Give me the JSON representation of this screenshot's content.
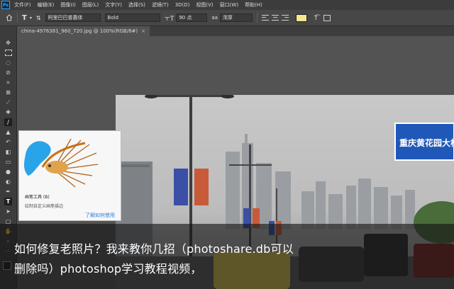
{
  "app": {
    "logo": "Ps"
  },
  "menu": [
    "文件(F)",
    "编辑(E)",
    "图像(I)",
    "图层(L)",
    "文字(Y)",
    "选择(S)",
    "滤镜(T)",
    "3D(D)",
    "视图(V)",
    "窗口(W)",
    "帮助(H)"
  ],
  "options": {
    "tool_icon": "T",
    "font_family": "阿里巴巴普惠体",
    "font_style": "Bold",
    "font_size": "90 点",
    "antialias": "浑厚",
    "text_color": "#f5e78f"
  },
  "document_tab": {
    "title": "china-4976381_960_720.jpg @ 100%(RGB/8#)",
    "close": "×"
  },
  "tools": [
    "move-icon",
    "marquee-icon",
    "lasso-icon",
    "quick-select-icon",
    "crop-icon",
    "frame-icon",
    "eyedropper-icon",
    "healing-icon",
    "brush-icon",
    "stamp-icon",
    "history-brush-icon",
    "eraser-icon",
    "gradient-icon",
    "blur-icon",
    "dodge-icon",
    "pen-icon",
    "type-icon",
    "path-select-icon",
    "shape-icon",
    "hand-icon",
    "zoom-icon",
    "more-icon"
  ],
  "tooltip": {
    "title": "画笔工具 (B)",
    "description": "绘制自定义画笔描边",
    "link": "了解如何使用"
  },
  "photo": {
    "sign_text": "重庆黄花园大桥"
  },
  "caption": {
    "line1": "如何修复老照片？我来教你几招（photoshare.db可以",
    "line2": "删除吗）photoshop学习教程视频，"
  }
}
